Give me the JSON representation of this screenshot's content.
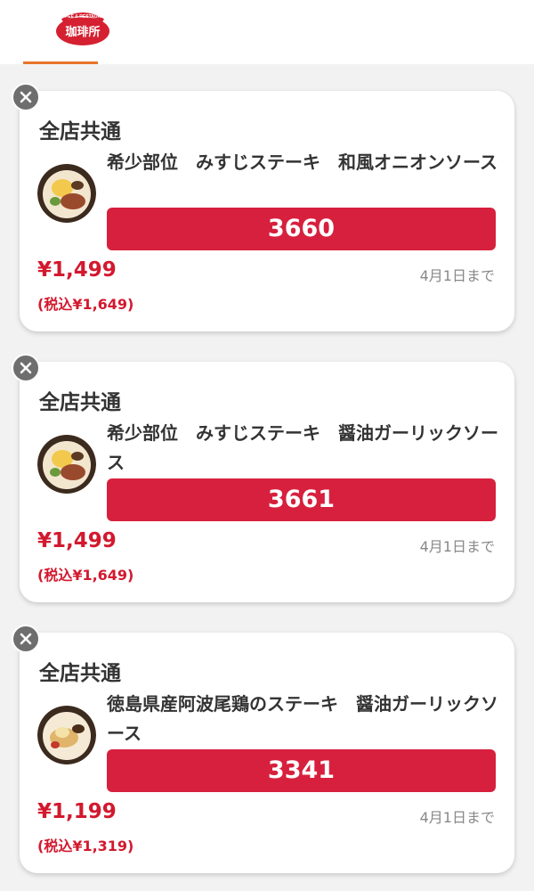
{
  "header": {
    "logo_alt": "COFFEE & RESTAURANT 珈琲所コメダ珈琲店"
  },
  "coupons": [
    {
      "scope": "全店共通",
      "title": "希少部位　みすじステーキ　和風オニオンソース",
      "code": "3660",
      "price": "¥1,499",
      "price_tax": "(税込¥1,649)",
      "expiry": "4月1日まで",
      "dish_icon": "steak-dish-icon"
    },
    {
      "scope": "全店共通",
      "title": "希少部位　みすじステーキ　醤油ガーリックソース",
      "code": "3661",
      "price": "¥1,499",
      "price_tax": "(税込¥1,649)",
      "expiry": "4月1日まで",
      "dish_icon": "steak-dish-icon"
    },
    {
      "scope": "全店共通",
      "title": "徳島県産阿波尾鶏のステーキ　醤油ガーリックソース",
      "code": "3341",
      "price": "¥1,199",
      "price_tax": "(税込¥1,319)",
      "expiry": "4月1日まで",
      "dish_icon": "chicken-steak-dish-icon"
    }
  ],
  "colors": {
    "accent_red": "#d7203d",
    "price_red": "#d2192e",
    "tab_underline": "#e8742a",
    "close_button": "#6e6e6e"
  }
}
